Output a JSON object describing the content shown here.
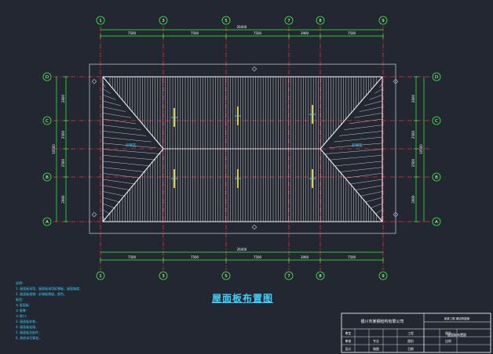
{
  "drawing": {
    "title": "屋面板布置图",
    "axes_top": [
      "1",
      "3",
      "5",
      "7",
      "8",
      "9"
    ],
    "axes_bottom": [
      "1",
      "3",
      "5",
      "7",
      "8",
      "9"
    ],
    "axes_left": [
      "D",
      "C",
      "B",
      "A"
    ],
    "axes_right": [
      "D",
      "C",
      "B",
      "A"
    ],
    "dims_top": [
      "7500",
      "7500",
      "7500",
      "3900",
      "7500"
    ],
    "dims_top_total": "26400",
    "dims_bottom": [
      "7500",
      "7500",
      "7500",
      "3900",
      "7500"
    ],
    "dims_bottom_total": "26400",
    "dims_left": [
      "2600",
      "2500",
      "2500",
      "2900"
    ],
    "dims_left_total": "10500",
    "dims_right": [
      "2600",
      "2500",
      "2500",
      "2900"
    ],
    "dims_right_total": "10500",
    "hip_labels": [
      "彩钢瓦",
      "彩钢瓦"
    ]
  },
  "notes": {
    "lines": [
      "说明：",
      "1. 屋面板采用，屋面板采用彩钢板，屋面坡度，",
      "2. 屋面板规格：彩钢板厚度，颜色，",
      "   板型：",
      "   ① 屋面板：",
      "   ② 屋脊：",
      "   ③ 檐口：",
      "3. 屋面板安装，",
      "4. 屋面板连接，",
      "5. 屋面板及配件，",
      "6. 其他未尽事宜，"
    ]
  },
  "title_block": {
    "company": "银川市某钢结构有限公司",
    "project": "某某工程 钢结构屋面",
    "sheet_title": "屋面板布置图",
    "rows": [
      [
        "审定",
        "",
        "",
        "",
        "工程",
        "",
        "图号",
        ""
      ],
      [
        "审核",
        "",
        "专业",
        "",
        "图别",
        "",
        "比例",
        ""
      ],
      [
        "设计",
        "",
        "制图",
        "",
        "日期",
        "",
        "",
        ""
      ]
    ]
  },
  "colors": {
    "background": "#222731",
    "grid_line": "#ff2a3a",
    "dimension": "#2fff2f",
    "roof_outline": "#ffffff",
    "roof_hatch": "#c8c8c8",
    "text": "#3fd0ff",
    "purlin_marker": "#ffff40"
  }
}
